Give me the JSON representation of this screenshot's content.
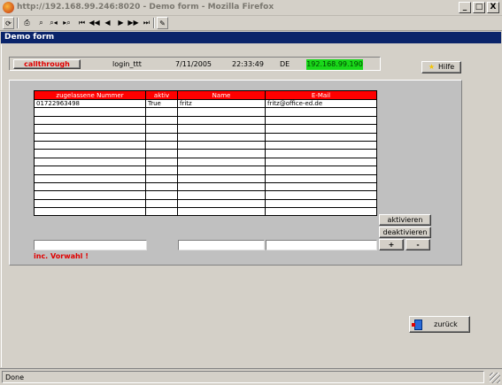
{
  "window": {
    "title": "http://192.168.99.246:8020 - Demo form - Mozilla Firefox",
    "controls": [
      "_",
      "□",
      "X"
    ]
  },
  "toolbar": {
    "buttons": [
      {
        "name": "reload-icon",
        "glyph": "⟳"
      },
      {
        "name": "print-icon",
        "glyph": "⎙"
      },
      {
        "name": "find-icon",
        "glyph": "⌕"
      },
      {
        "name": "find-prev-icon",
        "glyph": "⌕◂"
      },
      {
        "name": "find-next-icon",
        "glyph": "▸⌕"
      },
      {
        "name": "first-record-icon",
        "glyph": "⏮"
      },
      {
        "name": "prev-page-icon",
        "glyph": "◀◀"
      },
      {
        "name": "prev-record-icon",
        "glyph": "◀"
      },
      {
        "name": "next-record-icon",
        "glyph": "▶"
      },
      {
        "name": "next-page-icon",
        "glyph": "▶▶"
      },
      {
        "name": "last-record-icon",
        "glyph": "⏭"
      },
      {
        "name": "edit-icon",
        "glyph": "✎"
      }
    ]
  },
  "app": {
    "title": "Demo form"
  },
  "info": {
    "callthrough_label": "callthrough",
    "login": "login_ttt",
    "date": "7/11/2005",
    "time": "22:33:49",
    "lang": "DE",
    "ip": "192.168.99.190",
    "hilfe_label": "Hilfe"
  },
  "table": {
    "columns": [
      "zugelassene Nummer",
      "aktiv",
      "Name",
      "E-Mail"
    ],
    "rows": [
      [
        "01722963498",
        "True",
        "fritz",
        "fritz@office-ed.de"
      ],
      [
        "",
        "",
        "",
        ""
      ],
      [
        "",
        "",
        "",
        ""
      ],
      [
        "",
        "",
        "",
        ""
      ],
      [
        "",
        "",
        "",
        ""
      ],
      [
        "",
        "",
        "",
        ""
      ],
      [
        "",
        "",
        "",
        ""
      ],
      [
        "",
        "",
        "",
        ""
      ],
      [
        "",
        "",
        "",
        ""
      ],
      [
        "",
        "",
        "",
        ""
      ],
      [
        "",
        "",
        "",
        ""
      ],
      [
        "",
        "",
        "",
        ""
      ],
      [
        "",
        "",
        "",
        ""
      ],
      [
        "",
        "",
        "",
        ""
      ]
    ]
  },
  "side_buttons": {
    "aktivieren": "aktivieren",
    "deaktivieren": "deaktivieren",
    "plus": "+",
    "minus": "-"
  },
  "inputs": {
    "number_value": "",
    "name_value": "",
    "email_value": ""
  },
  "hint": "inc. Vorwahl !",
  "zurueck_label": "zurück",
  "status": {
    "text": "Done"
  }
}
